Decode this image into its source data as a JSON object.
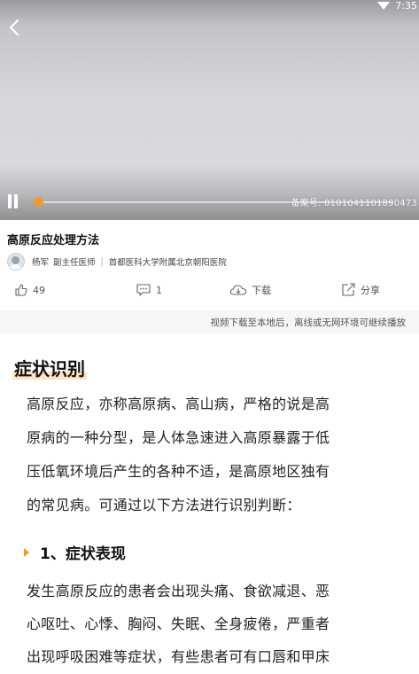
{
  "status_bar": {
    "time": "7:35"
  },
  "player": {
    "record_number": "备案号: 0101041101890473"
  },
  "video": {
    "title": "高原反应处理方法",
    "doctor": {
      "name": "杨军",
      "title": "副主任医师",
      "hospital": "首都医科大学附属北京朝阳医院"
    }
  },
  "actions": {
    "like_count": "49",
    "comment_count": "1",
    "download_label": "下载",
    "share_label": "分享"
  },
  "offline_notice": "视频下载至本地后，离线或无网环境可继续播放",
  "article": {
    "section_title": "症状识别",
    "intro_lines": [
      "高原反应，亦称高原病、高山病，严格的说是高",
      "原病的一种分型，是人体急速进入高原暴露于低",
      "压低氧环境后产生的各种不适，是高原地区独有",
      "的常见病。可通过以下方法进行识别判断："
    ],
    "sub_title": "1、症状表现",
    "symptom_lines": [
      "发生高原反应的患者会出现头痛、食欲减退、恶",
      "心呕吐、心悸、胸闷、失眠、全身疲倦，严重者",
      "出现呼吸困难等症状，有些患者可有口唇和甲床"
    ]
  },
  "icons": {
    "back": "chevron-left-icon",
    "pause": "pause-icon",
    "like": "thumbs-up-icon",
    "comment": "comment-icon",
    "download": "cloud-download-icon",
    "share": "share-icon"
  },
  "colors": {
    "accent": "#f2992e",
    "highlight": "#fbe3c5"
  }
}
